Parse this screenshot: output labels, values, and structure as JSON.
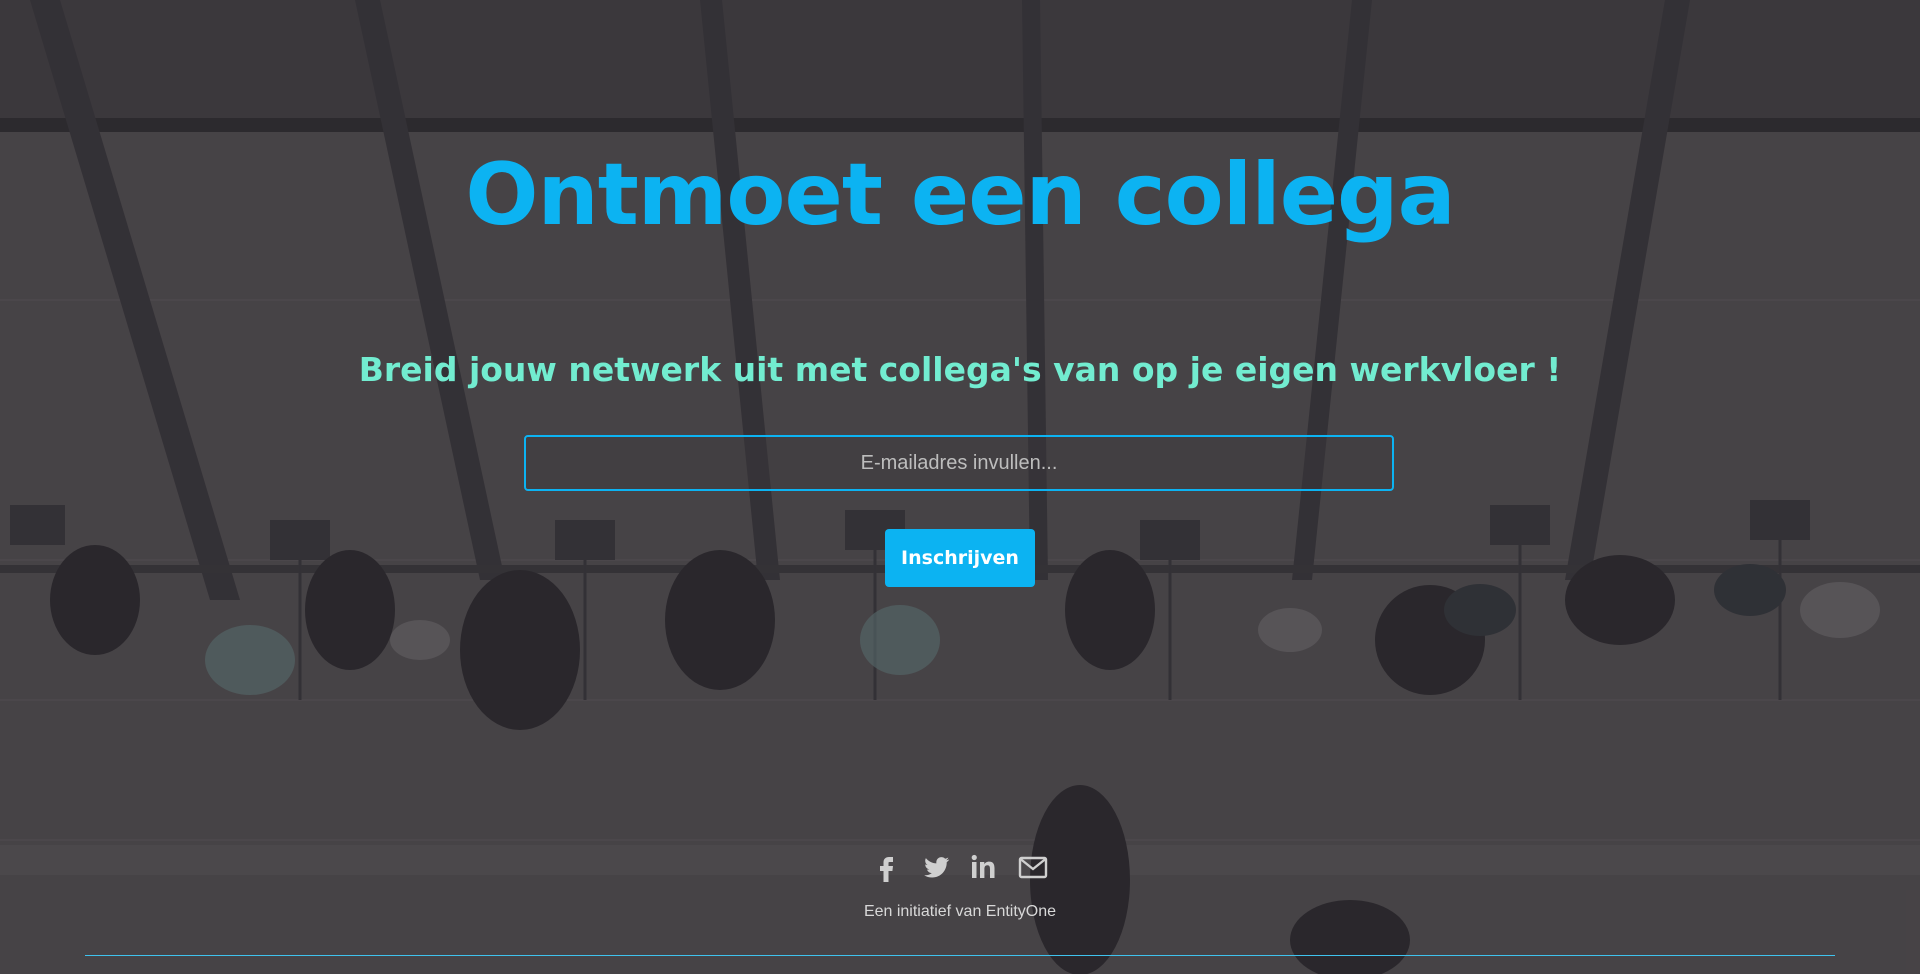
{
  "hero": {
    "title": "Ontmoet een collega",
    "subtitle": "Breid jouw netwerk uit met collega's van op je eigen werkvloer !"
  },
  "form": {
    "email_placeholder": "E-mailadres invullen...",
    "email_value": "",
    "subscribe_label": "Inschrijven"
  },
  "social": {
    "icons": [
      "facebook-icon",
      "twitter-icon",
      "linkedin-icon",
      "envelope-icon"
    ]
  },
  "footer": {
    "text": "Een initiatief van EntityOne"
  },
  "colors": {
    "accent": "#0cb3f2",
    "subtitle": "#72ecd0",
    "background_overlay": "#4a4648",
    "icon": "#cfcfcf",
    "footer_text": "#d8d8d8"
  }
}
